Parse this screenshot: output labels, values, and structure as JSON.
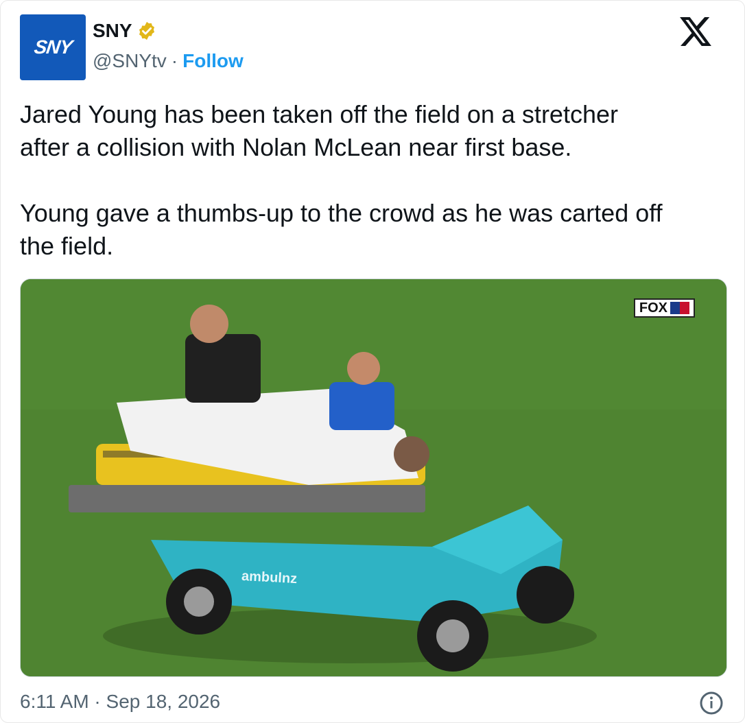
{
  "author": {
    "name": "SNY",
    "handle": "@SNYtv",
    "separator": "·",
    "follow_label": "Follow",
    "avatar_text": "SNY"
  },
  "tweet": {
    "text": "Jared Young has been taken off the field on a stretcher\nafter a collision with Nolan McLean near first base.\n\nYoung gave a thumbs-up to the crowd as he was carted off\nthe field."
  },
  "media": {
    "network_badge": "FOX",
    "cart_brand": "ambulnz"
  },
  "footer": {
    "timestamp": "6:11 AM · Sep 18, 2026"
  },
  "colors": {
    "accent": "#1d9bf0",
    "verified": "#e2b719",
    "avatar_bg": "#1259b9"
  },
  "icons": {
    "verified": "verified-badge-icon",
    "platform": "x-logo-icon",
    "info": "info-icon"
  }
}
